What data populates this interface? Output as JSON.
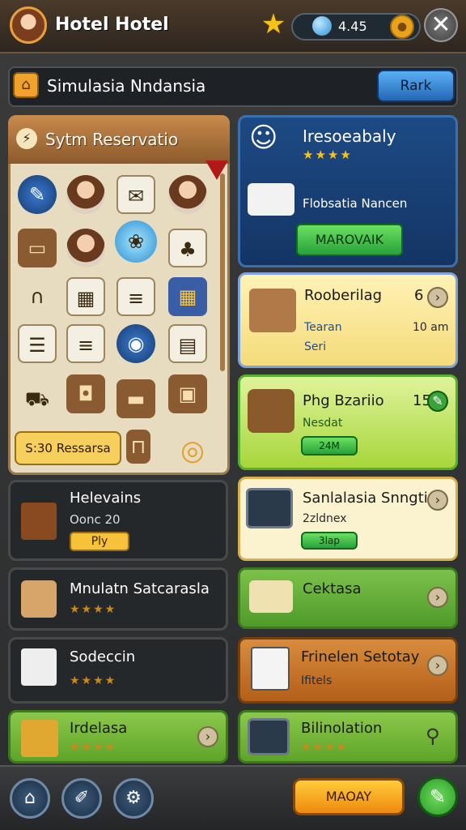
{
  "app": {
    "title": "Hotel Hotel",
    "currency_value": "4.45"
  },
  "subbar": {
    "title": "Simulasia Nndansia",
    "rank_label": "Rark"
  },
  "reservation": {
    "title": "Sytm Reservatio",
    "footer_label": "S:30 Ressarsa",
    "items": [
      "wrench-icon",
      "receptionist-face",
      "map-note-icon",
      "receptionist-face",
      "table-icon",
      "receptionist-face",
      "beach-brochure-icon",
      "palm-sign-icon",
      "rope-icon",
      "panel-icon",
      "towels-icon",
      "panel-icon",
      "clipboard-icon",
      "towels-icon",
      "globe-icon",
      "calendar-icon",
      "cart-icon",
      "bag-icon",
      "bed-icon",
      "suitcase-icon",
      "trolley-icon",
      "donut-icon"
    ]
  },
  "cards_right": [
    {
      "title": "Iresoeabaly",
      "stars": "★★★★",
      "sub": "Flobsatia Nancen",
      "button": "MAROVAIK"
    },
    {
      "title": "Rooberilag",
      "number": "6",
      "line1": "Tearan",
      "time": "10 am",
      "line2": "Seri"
    },
    {
      "title": "Phg Bzariio",
      "number": "15",
      "line1": "Nesdat",
      "button": "24M"
    },
    {
      "title": "Sanlalasia Snngtian",
      "line1": "2zldnex",
      "button": "3lap"
    },
    {
      "title": "Cektasa"
    },
    {
      "title": "Frinelen Setotay",
      "line1": "Ifitels"
    },
    {
      "title": "Bilinolation",
      "stars": "★★★★"
    }
  ],
  "cards_left": [
    {
      "title": "Helevains",
      "sub": "Oonc 20",
      "button": "Ply"
    },
    {
      "title": "Mnulatn Satcarasla",
      "stars": "★★★★"
    },
    {
      "title": "Sodeccin",
      "stars": "★★★★"
    },
    {
      "title": "Irdelasa",
      "stars": "★★★★"
    }
  ],
  "bottom": {
    "main_button": "MAOAY"
  }
}
